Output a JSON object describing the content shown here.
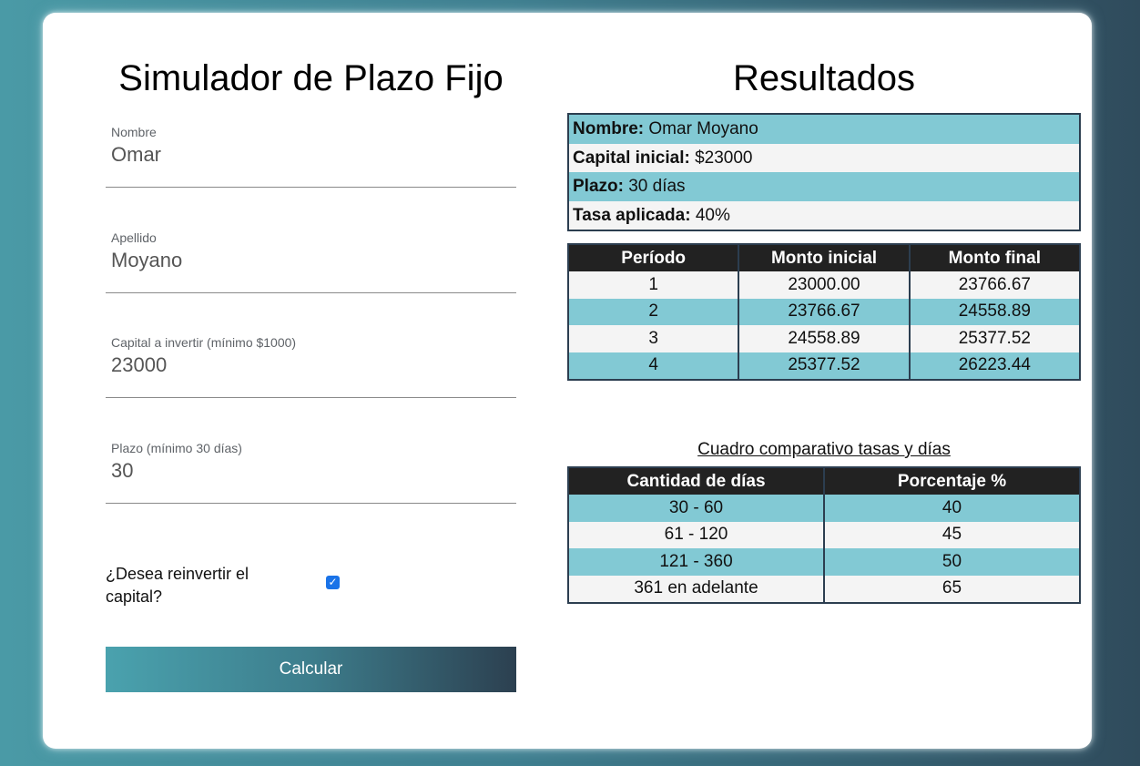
{
  "form": {
    "title": "Simulador de Plazo Fijo",
    "fields": [
      {
        "label": "Nombre",
        "value": "Omar"
      },
      {
        "label": "Apellido",
        "value": "Moyano"
      },
      {
        "label": "Capital a invertir (mínimo $1000)",
        "value": "23000"
      },
      {
        "label": "Plazo (mínimo 30 días)",
        "value": "30"
      }
    ],
    "reinvest_label": "¿Desea reinvertir el capital?",
    "reinvest_checked": true,
    "check_glyph": "✓",
    "submit_label": "Calcular"
  },
  "results": {
    "title": "Resultados",
    "summary": [
      {
        "label": "Nombre:",
        "value": "Omar Moyano"
      },
      {
        "label": "Capital inicial:",
        "value": "$23000"
      },
      {
        "label": "Plazo:",
        "value": "30 días"
      },
      {
        "label": "Tasa aplicada:",
        "value": "40%"
      }
    ],
    "periods_table": {
      "headers": [
        "Período",
        "Monto inicial",
        "Monto final"
      ],
      "rows": [
        [
          "1",
          "23000.00",
          "23766.67"
        ],
        [
          "2",
          "23766.67",
          "24558.89"
        ],
        [
          "3",
          "24558.89",
          "25377.52"
        ],
        [
          "4",
          "25377.52",
          "26223.44"
        ]
      ]
    },
    "rates_caption": "Cuadro comparativo tasas y días",
    "rates_table": {
      "headers": [
        "Cantidad de días",
        "Porcentaje %"
      ],
      "rows": [
        [
          "30 - 60",
          "40"
        ],
        [
          "61 - 120",
          "45"
        ],
        [
          "121 - 360",
          "50"
        ],
        [
          "361 en adelante",
          "65"
        ]
      ]
    }
  },
  "colors": {
    "row_accent": "#82c9d4",
    "row_light": "#f4f4f4",
    "header_dark": "#222222",
    "border": "#2c3e50"
  }
}
